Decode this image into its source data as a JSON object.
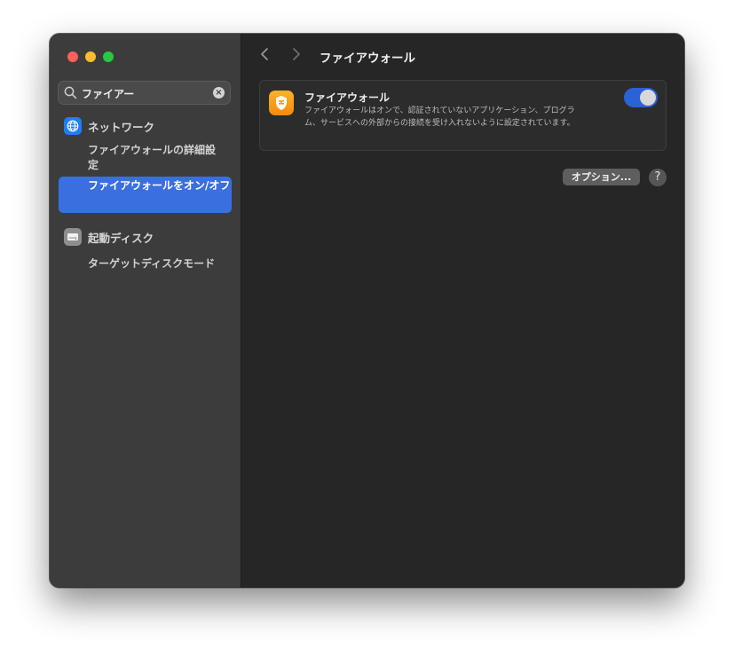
{
  "search": {
    "value": "ファイアー",
    "clear_icon": "xmark-circle-icon",
    "search_icon": "magnifier-icon"
  },
  "sidebar": {
    "categories": [
      {
        "label": "ネットワーク",
        "icon": "globe-icon",
        "icon_color": "#1f7ef0",
        "items": [
          {
            "label": "ファイアウォールの詳細設定",
            "selected": false
          },
          {
            "label": "ファイアウォールをオン/オフ",
            "selected": true
          }
        ]
      },
      {
        "label": "起動ディスク",
        "icon": "disk-icon",
        "icon_color": "#8e8e8e",
        "items": [
          {
            "label": "ターゲットディスクモード",
            "selected": false
          }
        ]
      }
    ]
  },
  "toolbar": {
    "title": "ファイアウォール",
    "back_icon": "chevron-left-icon",
    "forward_icon": "chevron-right-icon"
  },
  "firewall": {
    "title": "ファイアウォール",
    "description": "ファイアウォールはオンで、認証されていないアプリケーション、プログラム、サービスへの外部からの接続を受け入れないように設定されています。",
    "enabled": true,
    "icon": "firewall-shield-icon",
    "icon_color": "#f5a21f",
    "toggle_color": "#2c62d8"
  },
  "options_button": "オプション...",
  "help_button": "?",
  "colors": {
    "selection": "#3a6fe0",
    "sidebar_bg": "#3c3c3c",
    "main_bg": "#262626"
  }
}
